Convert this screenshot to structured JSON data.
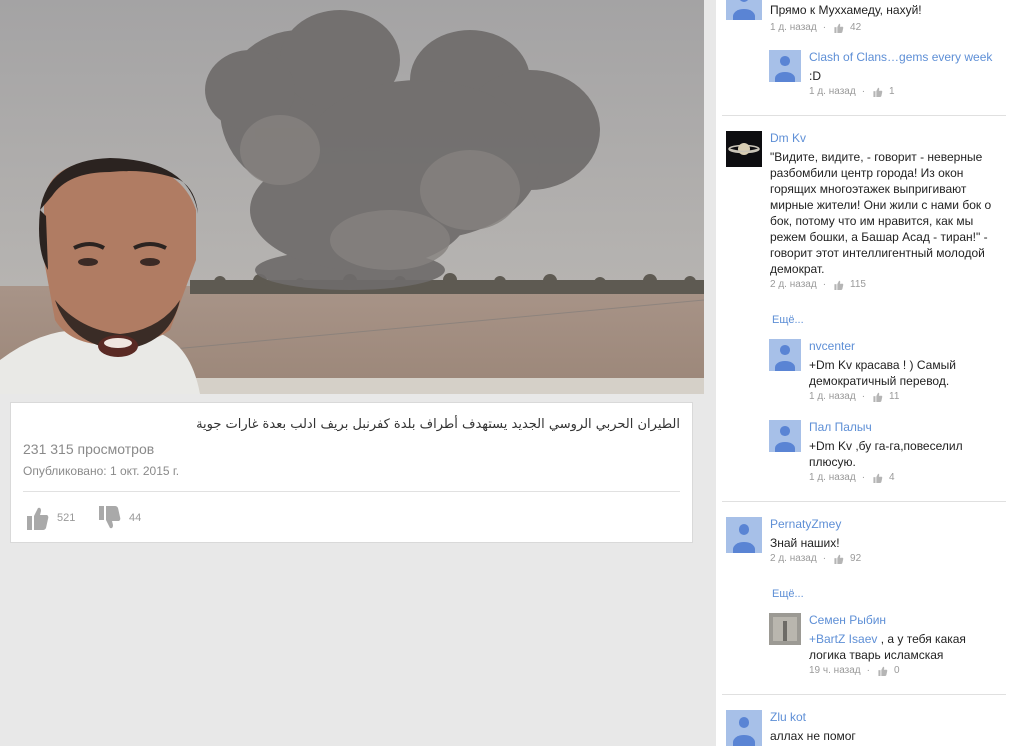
{
  "video": {
    "title": "الطيران الحربي الروسي الجديد يستهدف أطراف بلدة كفرنبل بريف ادلب بعدة غارات جوية",
    "views": "231 315 просмотров",
    "published": "Опубликовано: 1 окт. 2015 г.",
    "likes": "521",
    "dislikes": "44"
  },
  "comments": {
    "c1": {
      "text": "Прямо к Муххамеду, нахуй!",
      "time": "1 д. назад",
      "likes": "42"
    },
    "r1": {
      "author": "Clash of Clans…gems every week",
      "text": ":D",
      "time": "1 д. назад",
      "likes": "1"
    },
    "c2": {
      "author": "Dm Kv",
      "text": "\"Видите, видите, - говорит - неверные разбомбили центр города! Из окон горящих многоэтажек выпригивают мирные жители! Они жили с нами бок о бок, потому что им нравится, как мы режем бошки, а Башар Асад - тиран!\" - говорит этот интеллигентный молодой демократ.",
      "time": "2 д. назад",
      "likes": "115"
    },
    "more1": "Ещё...",
    "r2": {
      "author": "nvcenter",
      "text": "+Dm Kv красава ! ) Самый демократичный перевод.",
      "time": "1 д. назад",
      "likes": "11"
    },
    "r3": {
      "author": "Пал Палыч",
      "text": "+Dm Kv ,бу га-га,повеселил плюсую.",
      "time": "1 д. назад",
      "likes": "4"
    },
    "c3": {
      "author": "PernatyZmey",
      "text": "Знай наших!",
      "time": "2 д. назад",
      "likes": "92"
    },
    "more2": "Ещё...",
    "r4": {
      "author": "Семен Рыбин",
      "mention": "+BartZ Isaev",
      "text": " , а у тебя какая логика тварь исламская",
      "time": "19 ч. назад",
      "likes": "0"
    },
    "c4": {
      "author": "Zlu kot",
      "text": "аллах не помог"
    }
  },
  "colors": {
    "link": "#5e8fd6",
    "avatar_bg": "#a7c0e8",
    "avatar_fg": "#5a84d4"
  },
  "icons": [
    "thumb-up-icon",
    "thumb-down-icon",
    "default-avatar-icon"
  ]
}
